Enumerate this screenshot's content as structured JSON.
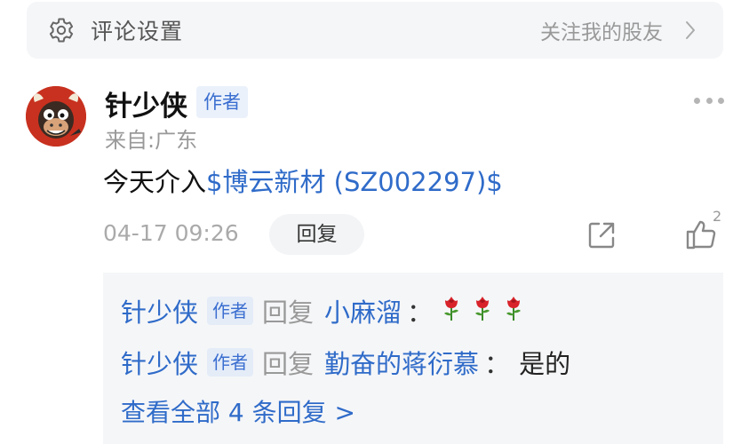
{
  "settings_bar": {
    "title": "评论设置",
    "follow_label": "关注我的股友",
    "icons": {
      "gear": "gear-icon",
      "chevron": "chevron-right-icon"
    }
  },
  "comment": {
    "username": "针少侠",
    "author_badge": "作者",
    "source": "来自:广东",
    "content_prefix": "今天介入",
    "stock_tag": "$博云新材 (SZ002297)$",
    "timestamp": "04-17 09:26",
    "reply_button": "回复",
    "like_count": "2",
    "avatar": "bull-cartoon-avatar"
  },
  "replies": {
    "items": [
      {
        "author": "针少侠",
        "badge": "作者",
        "verb": "回复",
        "target": "小麻溜",
        "colon": "：",
        "text": "",
        "emoji": "rose-emoji",
        "emoji_count": 3
      },
      {
        "author": "针少侠",
        "badge": "作者",
        "verb": "回复",
        "target": "勤奋的蒋衍慕",
        "colon": "：",
        "text": "是的"
      }
    ],
    "view_all": "查看全部 4 条回复 >"
  },
  "colors": {
    "link_blue": "#2f6bc9",
    "badge_bg": "#eaf1fb",
    "panel_bg": "#f5f6f8",
    "muted_text": "#999999"
  }
}
